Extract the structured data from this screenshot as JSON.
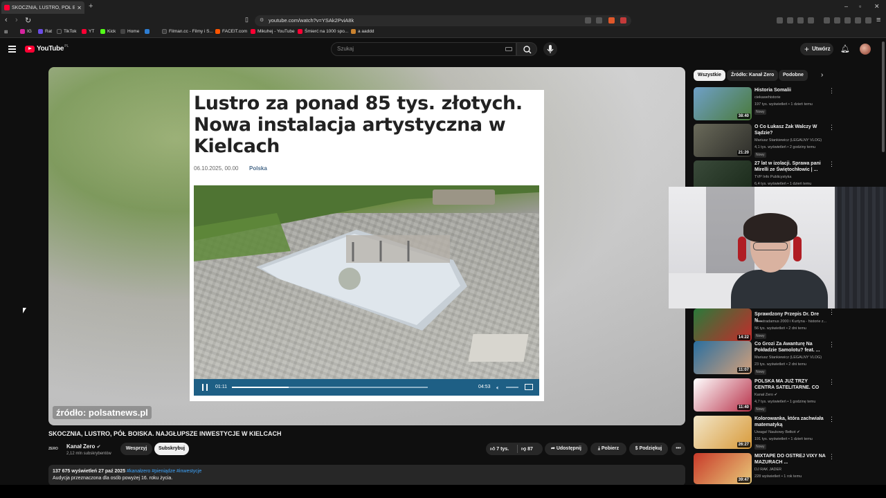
{
  "browser": {
    "tab_title": "SKOCZNIA, LUSTRO, PÓŁ BOI",
    "url": "youtube.com/watch?v=YSAk2PviA8k",
    "bookmarks": [
      {
        "label": "IG",
        "color": "#d6249f"
      },
      {
        "label": "Rat",
        "color": "#6b4ce6"
      },
      {
        "label": "TikTok",
        "color": "#222222"
      },
      {
        "label": "YT",
        "color": "#ff0033"
      },
      {
        "label": "Kick",
        "color": "#53fc18"
      },
      {
        "label": "Home",
        "color": "#444444"
      },
      {
        "label": "",
        "color": "#2d7dd2"
      },
      {
        "label": "Filman.cc - Filmy i S...",
        "color": "#3a3a3a"
      },
      {
        "label": "FACEIT.com",
        "color": "#ff5500"
      },
      {
        "label": "Mikuhej - YouTube",
        "color": "#ff0033"
      },
      {
        "label": "Śmierć na 1000 spo...",
        "color": "#ff0033"
      },
      {
        "label": "a aaddd",
        "color": "#c9822f"
      }
    ]
  },
  "masthead": {
    "logo": "YouTube",
    "logo_country": "PL",
    "search_placeholder": "Szukaj",
    "create_label": "Utwórz"
  },
  "video": {
    "article_headline": "Lustro za ponad 85 tys. złotych. Nowa instalacja artystyczna w Kielcach",
    "article_date": "06.10.2025, 00.00",
    "article_category": "Polska",
    "embedded_time_current": "01:11",
    "embedded_time_total": "04:53",
    "embedded_progress": 0.29,
    "source_caption": "źródło: polsatnews.pl",
    "title": "SKOCZNIA, LUSTRO, PÓŁ BOISKA. NAJGŁUPSZE INWESTYCJE W KIELCACH",
    "channel_logo_text": "ZERO",
    "channel_name": "Kanał Zero",
    "channel_subs": "2,12 mln subskrybentów",
    "support_label": "Wesprzyj",
    "subscribe_label": "Subskrybuj",
    "likes": "7 tys.",
    "dislikes": "87",
    "share_label": "Udostępnij",
    "download_label": "Pobierz",
    "thanks_label": "Podziękuj",
    "views": "137 675 wyświetleń",
    "date": "27 paź 2025",
    "tags": "#kanałzero #pieniądze #inwestycje",
    "description": "Audycja przeznaczona dla osób powyżej 16. roku życia."
  },
  "sidebar": {
    "chips": [
      "Wszystkie",
      "Źródło: Kanał Zero",
      "Podobne"
    ],
    "recommendations": [
      {
        "title": "Historia Somalii",
        "channel": "ciekawehistorie",
        "meta": "197 tys. wyświetleń • 1 dzień temu",
        "badge": "Nowy",
        "duration": "38:40",
        "thumb": "#6fa0c8"
      },
      {
        "title": "O Co Łukasz Żak Walczy W Sądzie?",
        "channel": "Mariusz Stankiewicz (LEGALNY VLOG)",
        "meta": "4,1 tys. wyświetleń • 2 godziny temu",
        "badge": "Nowy",
        "duration": "21:20",
        "thumb": "#5a5a52"
      },
      {
        "title": "27 lat w izolacji. Sprawa pani Mirelli ze Świętochłowic | ...",
        "channel": "TVP Info Publicystyka",
        "meta": "6,4 tys. wyświetleń • 1 dzień temu",
        "badge": "",
        "duration": "",
        "thumb": "#3a4a3a"
      },
      {
        "title": "Sprawdzony Przepis Dr. Dre N...",
        "channel": "Neostradamus 2000 i Kurtyna - historie z...",
        "meta": "56 tys. wyświetleń • 2 dni temu",
        "badge": "Nowy",
        "duration": "14:22",
        "thumb": "#c42b2b"
      },
      {
        "title": "Co Grozi Za Awanturę Na Pokładzie Samolotu? feat. ...",
        "channel": "Mariusz Stankiewicz (LEGALNY VLOG)",
        "meta": "23 tys. wyświetleń • 2 dni temu",
        "badge": "Nowy",
        "duration": "11:07",
        "thumb": "#2a6fa0"
      },
      {
        "title": "POLSKA MA JUŻ TRZY CENTRA SATELITARNE. CO ONE MAJĄ ...",
        "channel": "Kanał Zero",
        "meta": "4,7 tys. wyświetleń • 1 godzinę temu",
        "badge": "Nowy",
        "duration": "11:40",
        "thumb": "#b8324a"
      },
      {
        "title": "Kolorowanka, która zachwiała matematyką",
        "channel": "Uwaga! Naukowy Bełkot",
        "meta": "191 tys. wyświetleń • 1 dzień temu",
        "badge": "Nowy",
        "duration": "26:27",
        "thumb": "#d89a3a"
      },
      {
        "title": "MIXTAPE DO OSTREJ VIXY NA MAZURACH ...",
        "channel": "DJ RAK JADER",
        "meta": "228 wyświetleń • 1 rok temu",
        "badge": "",
        "duration": "39:47",
        "thumb": "#c83a2a"
      }
    ]
  }
}
